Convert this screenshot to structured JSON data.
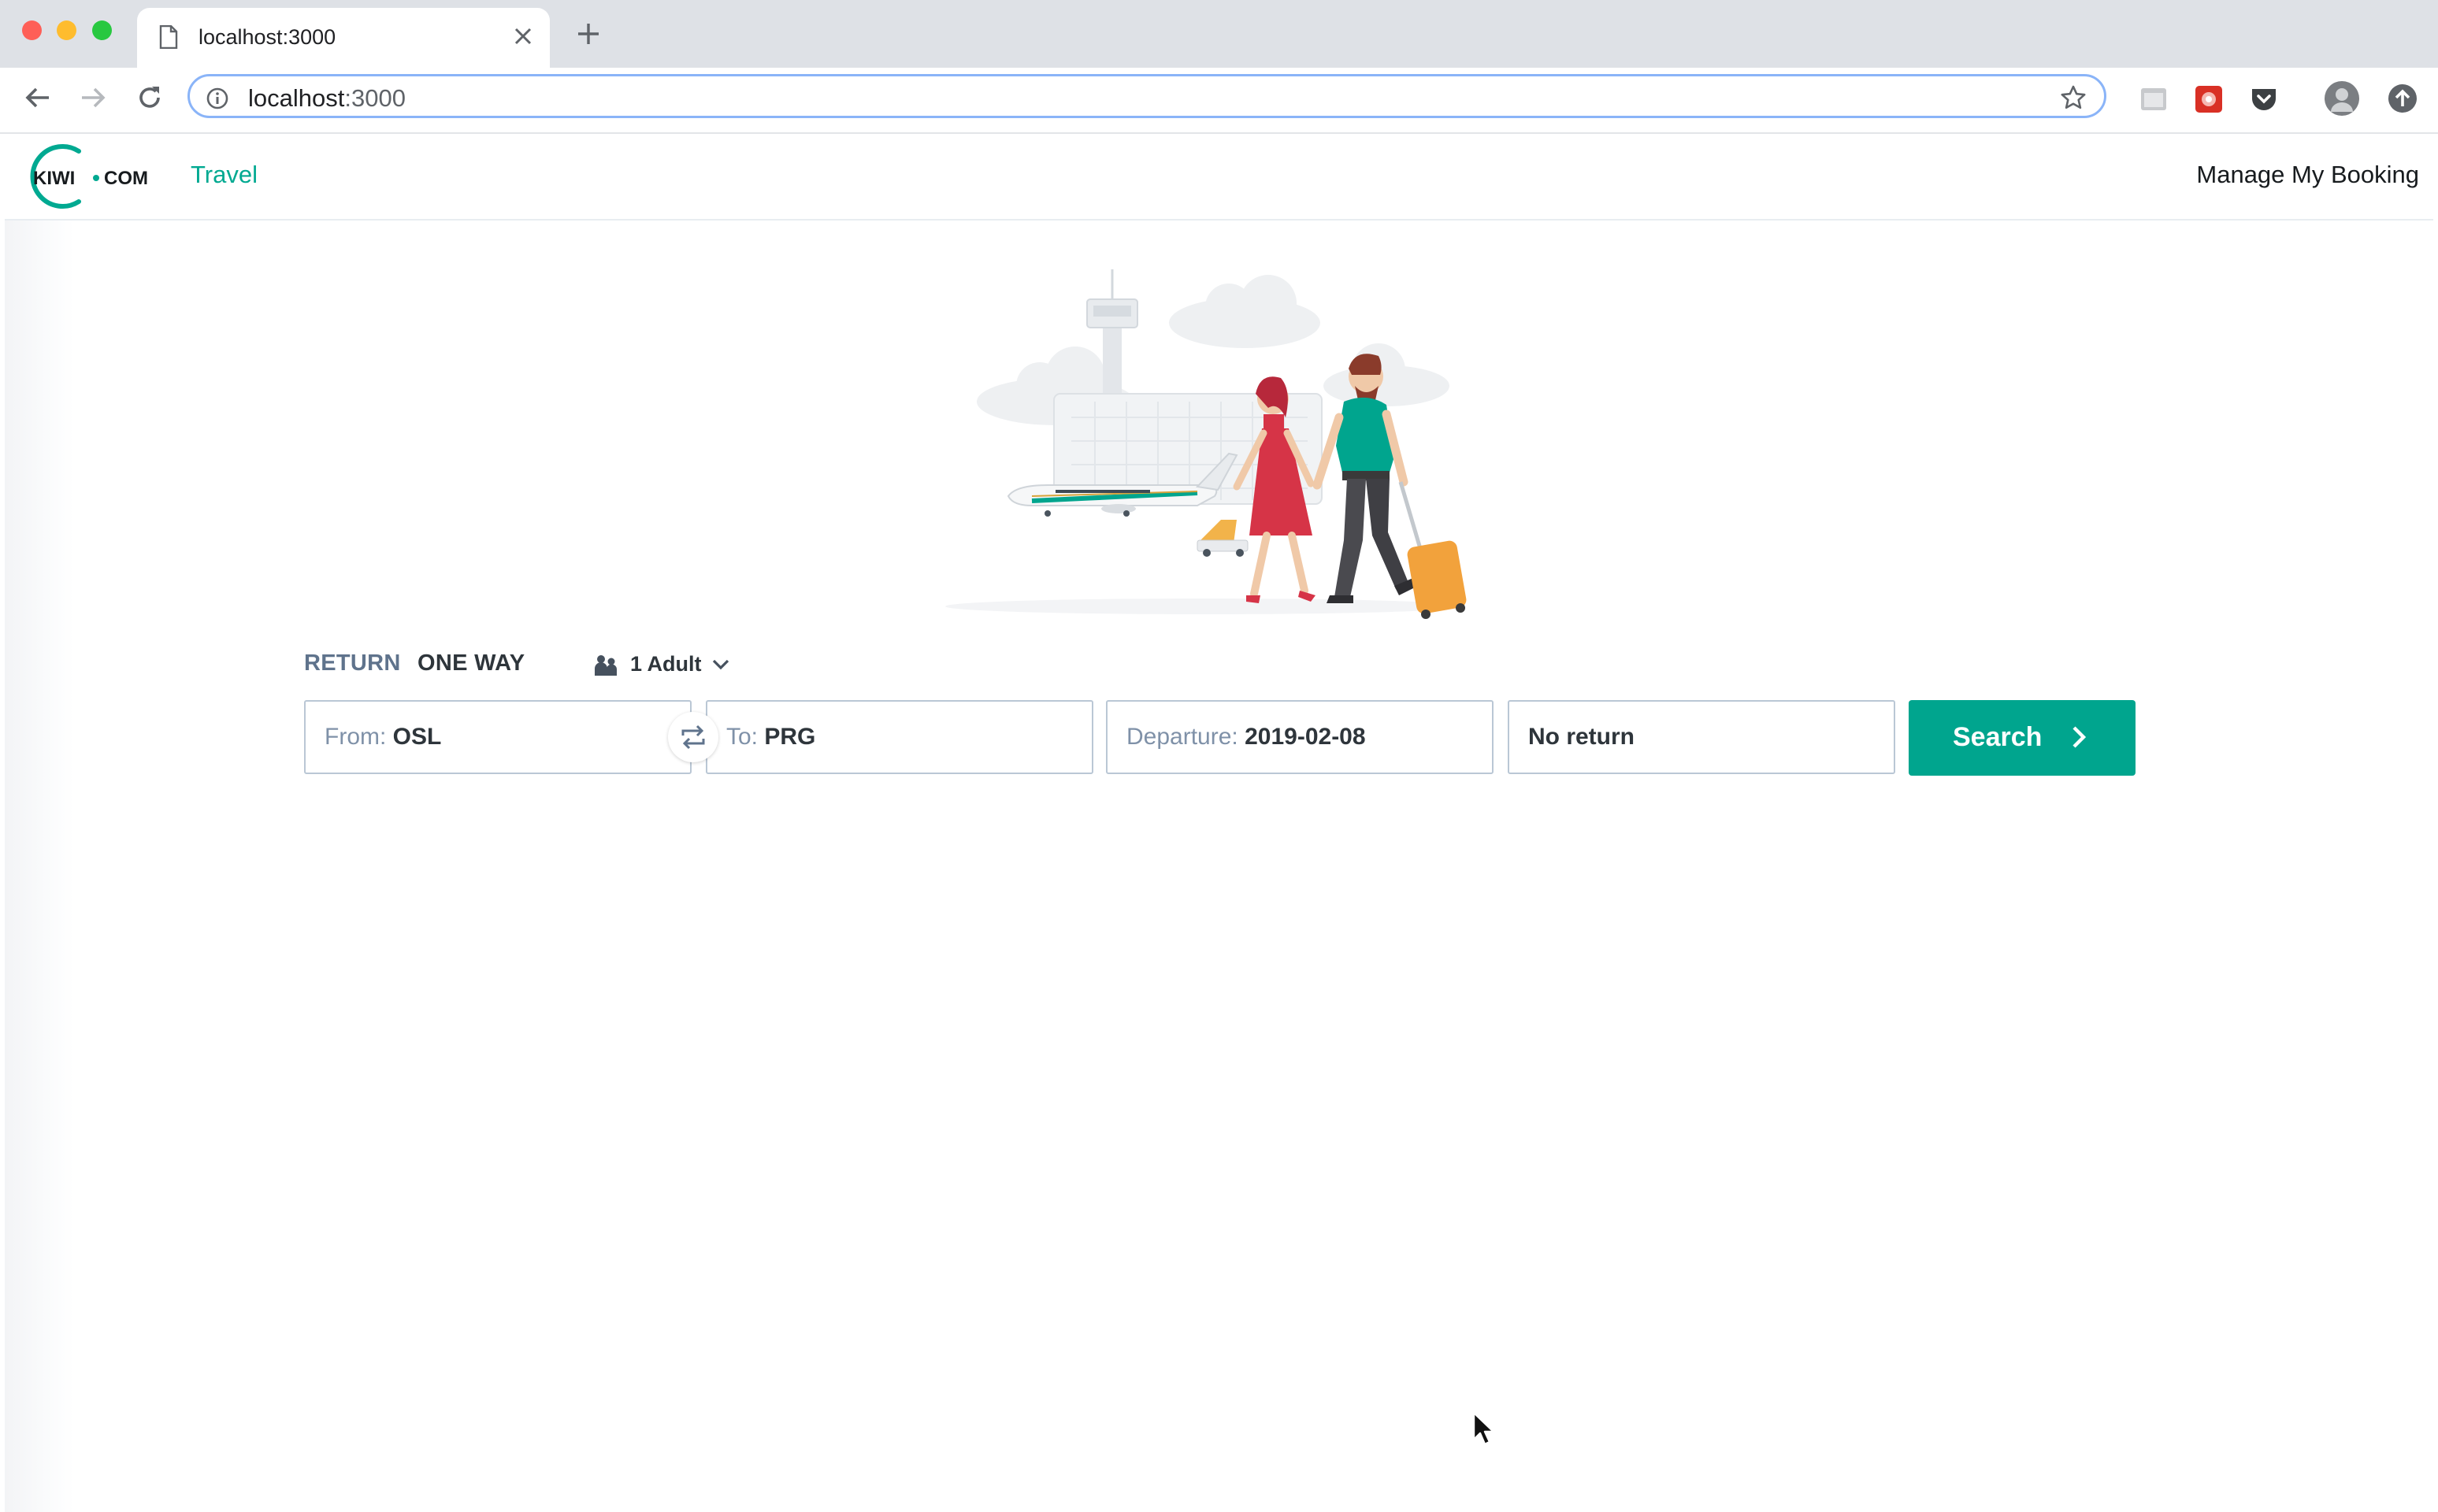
{
  "browser": {
    "tab_title": "localhost:3000",
    "url_host": "localhost",
    "url_port": ":3000"
  },
  "header": {
    "logo_text_left": "KIWI",
    "logo_text_right": "COM",
    "nav_travel": "Travel",
    "manage_booking": "Manage My Booking",
    "accent_color": "#00a991"
  },
  "search": {
    "trip_types": [
      "RETURN",
      "ONE WAY"
    ],
    "passengers": "1 Adult",
    "from": {
      "label": "From:",
      "value": "OSL"
    },
    "to": {
      "label": "To:",
      "value": "PRG"
    },
    "departure": {
      "label": "Departure:",
      "value": "2019-02-08"
    },
    "return": {
      "value": "No return"
    },
    "button": "Search"
  },
  "colors": {
    "primary_button": "#00a58e",
    "field_border": "#bac7d5",
    "label_gray": "#7f91a8"
  }
}
